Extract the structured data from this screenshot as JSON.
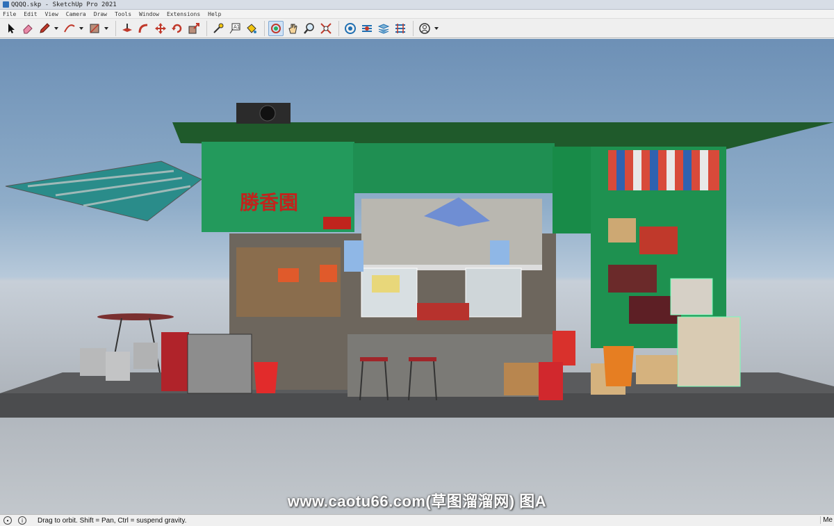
{
  "window": {
    "title": "QQQQ.skp - SketchUp Pro 2021"
  },
  "menu": [
    "File",
    "Edit",
    "View",
    "Camera",
    "Draw",
    "Tools",
    "Window",
    "Extensions",
    "Help"
  ],
  "toolbar": {
    "tools": [
      {
        "name": "select-icon"
      },
      {
        "name": "eraser-icon"
      },
      {
        "name": "pencil-icon",
        "caret": true
      },
      {
        "name": "arc-icon",
        "caret": true
      },
      {
        "name": "rectangle-icon",
        "caret": true
      },
      {
        "name": "push-pull-icon"
      },
      {
        "name": "follow-me-icon"
      },
      {
        "name": "move-icon"
      },
      {
        "name": "rotate-icon"
      },
      {
        "name": "scale-icon"
      },
      {
        "name": "tape-measure-icon"
      },
      {
        "name": "text-icon"
      },
      {
        "name": "paint-bucket-icon"
      },
      {
        "name": "orbit-icon",
        "active": true
      },
      {
        "name": "pan-icon"
      },
      {
        "name": "zoom-icon"
      },
      {
        "name": "zoom-extents-icon"
      },
      {
        "name": "warehouse-icon"
      },
      {
        "name": "extension-warehouse-icon"
      },
      {
        "name": "layout-icon"
      },
      {
        "name": "extension-manager-icon"
      },
      {
        "name": "account-icon",
        "caret": true
      }
    ]
  },
  "scene": {
    "shop_sign": "勝香園"
  },
  "watermark": "www.caotu66.com(草图溜溜网) 图A",
  "status": {
    "hint": "Drag to orbit. Shift = Pan, Ctrl = suspend gravity.",
    "measurements_label": "Me"
  }
}
